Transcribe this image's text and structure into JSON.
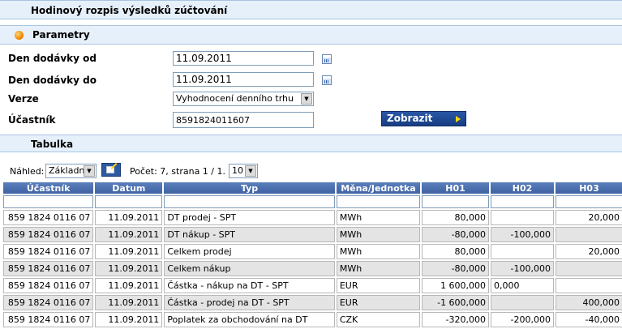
{
  "page_title": "Hodinový rozpis výsledků zúčtování",
  "parameters": {
    "section_title": "Parametry",
    "date_from_label": "Den dodávky od",
    "date_from_value": "11.09.2011",
    "date_to_label": "Den dodávky do",
    "date_to_value": "11.09.2011",
    "version_label": "Verze",
    "version_value": "Vyhodnocení denního trhu",
    "participant_label": "Účastník",
    "participant_value": "8591824011607",
    "show_button": "Zobrazit"
  },
  "table_section": {
    "title": "Tabulka",
    "view_label": "Náhled:",
    "view_value": "Základní",
    "count_text": "Počet: 7, strana 1 / 1.",
    "page_size": "10"
  },
  "grid": {
    "columns": [
      "Účastník",
      "Datum",
      "Typ",
      "Měna/Jednotka",
      "H01",
      "H02",
      "H03"
    ],
    "rows": [
      [
        "859 1824 0116 07",
        "11.09.2011",
        "DT prodej - SPT",
        "MWh",
        "80,000",
        "",
        "20,000"
      ],
      [
        "859 1824 0116 07",
        "11.09.2011",
        "DT nákup - SPT",
        "MWh",
        "-80,000",
        "-100,000",
        ""
      ],
      [
        "859 1824 0116 07",
        "11.09.2011",
        "Celkem prodej",
        "MWh",
        "80,000",
        "",
        "20,000"
      ],
      [
        "859 1824 0116 07",
        "11.09.2011",
        "Celkem nákup",
        "MWh",
        "-80,000",
        "-100,000",
        ""
      ],
      [
        "859 1824 0116 07",
        "11.09.2011",
        "Částka - nákup na DT - SPT",
        "EUR",
        "1 600,000",
        "0,000",
        ""
      ],
      [
        "859 1824 0116 07",
        "11.09.2011",
        "Částka - prodej na DT - SPT",
        "EUR",
        "-1 600,000",
        "",
        "400,000"
      ],
      [
        "859 1824 0116 07",
        "11.09.2011",
        "Poplatek za obchodování na DT",
        "CZK",
        "-320,000",
        "-200,000",
        "-40,000"
      ]
    ]
  },
  "colors": {
    "header_bar": "#e6f0fa",
    "grid_header": "#4a70b0",
    "button": "#1f4a94"
  }
}
